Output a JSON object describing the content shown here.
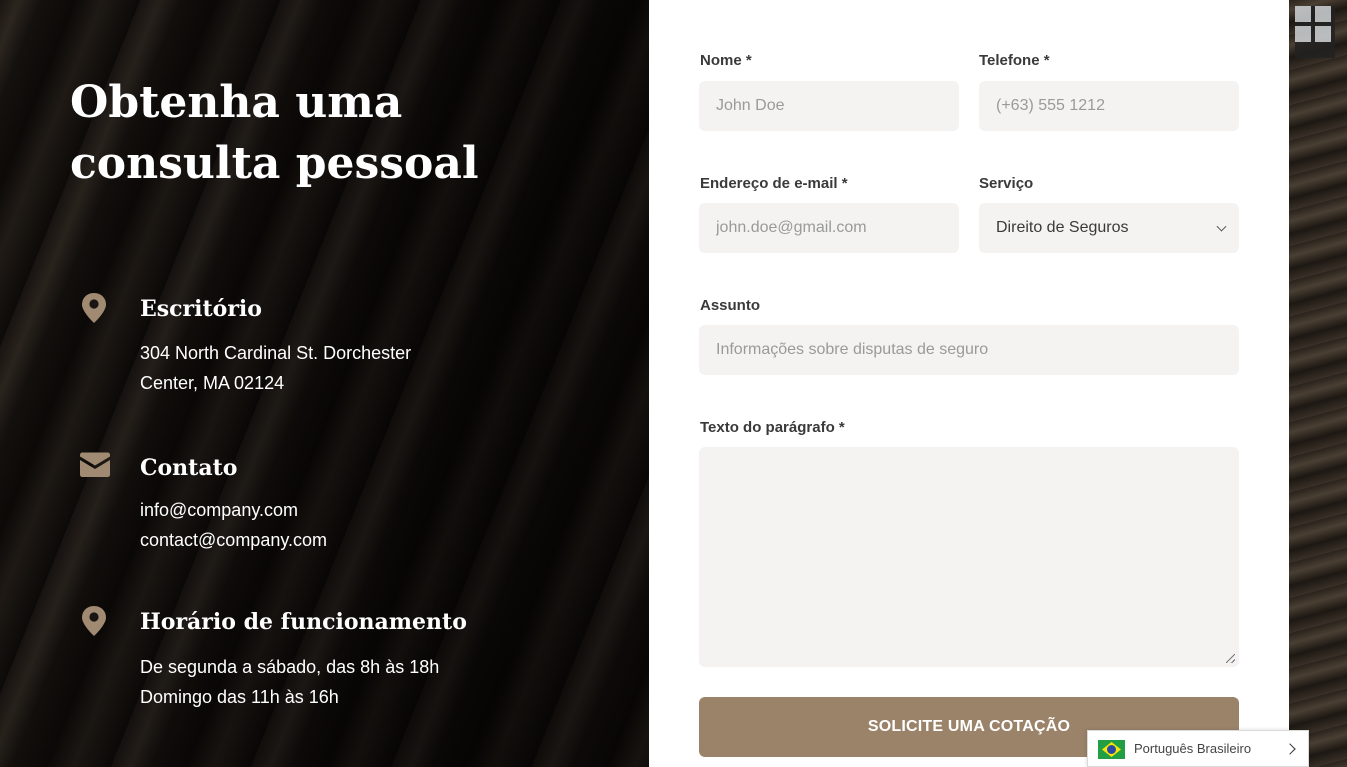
{
  "hero": {
    "title": "Obtenha uma consulta pessoal"
  },
  "info": {
    "office": {
      "icon": "map-pin-icon",
      "title": "Escritório",
      "lines": [
        "304 North Cardinal St. Dorchester",
        "Center, MA 02124"
      ]
    },
    "contact": {
      "icon": "envelope-icon",
      "title": "Contato",
      "lines": [
        "info@company.com",
        "contact@company.com"
      ]
    },
    "hours": {
      "icon": "map-pin-icon",
      "title": "Horário de funcionamento",
      "lines": [
        "De segunda a sábado, das 8h às 18h",
        "Domingo das 11h às 16h"
      ]
    }
  },
  "form": {
    "name": {
      "label": "Nome *",
      "placeholder": "John Doe"
    },
    "phone": {
      "label": "Telefone *",
      "placeholder": "(+63) 555 1212"
    },
    "email": {
      "label": "Endereço de e-mail *",
      "placeholder": "john.doe@gmail.com"
    },
    "service": {
      "label": "Serviço",
      "value": "Direito de Seguros"
    },
    "subject": {
      "label": "Assunto",
      "placeholder": "Informações sobre disputas de seguro"
    },
    "message": {
      "label": "Texto do parágrafo *"
    },
    "submit_label": "SOLICITE UMA COTAÇÃO"
  },
  "language": {
    "label": "Português Brasileiro",
    "flag": "brazil-flag-icon"
  },
  "colors": {
    "accent": "#9b836a",
    "field_bg": "#f4f3f1",
    "panel_bg": "#ffffff"
  }
}
